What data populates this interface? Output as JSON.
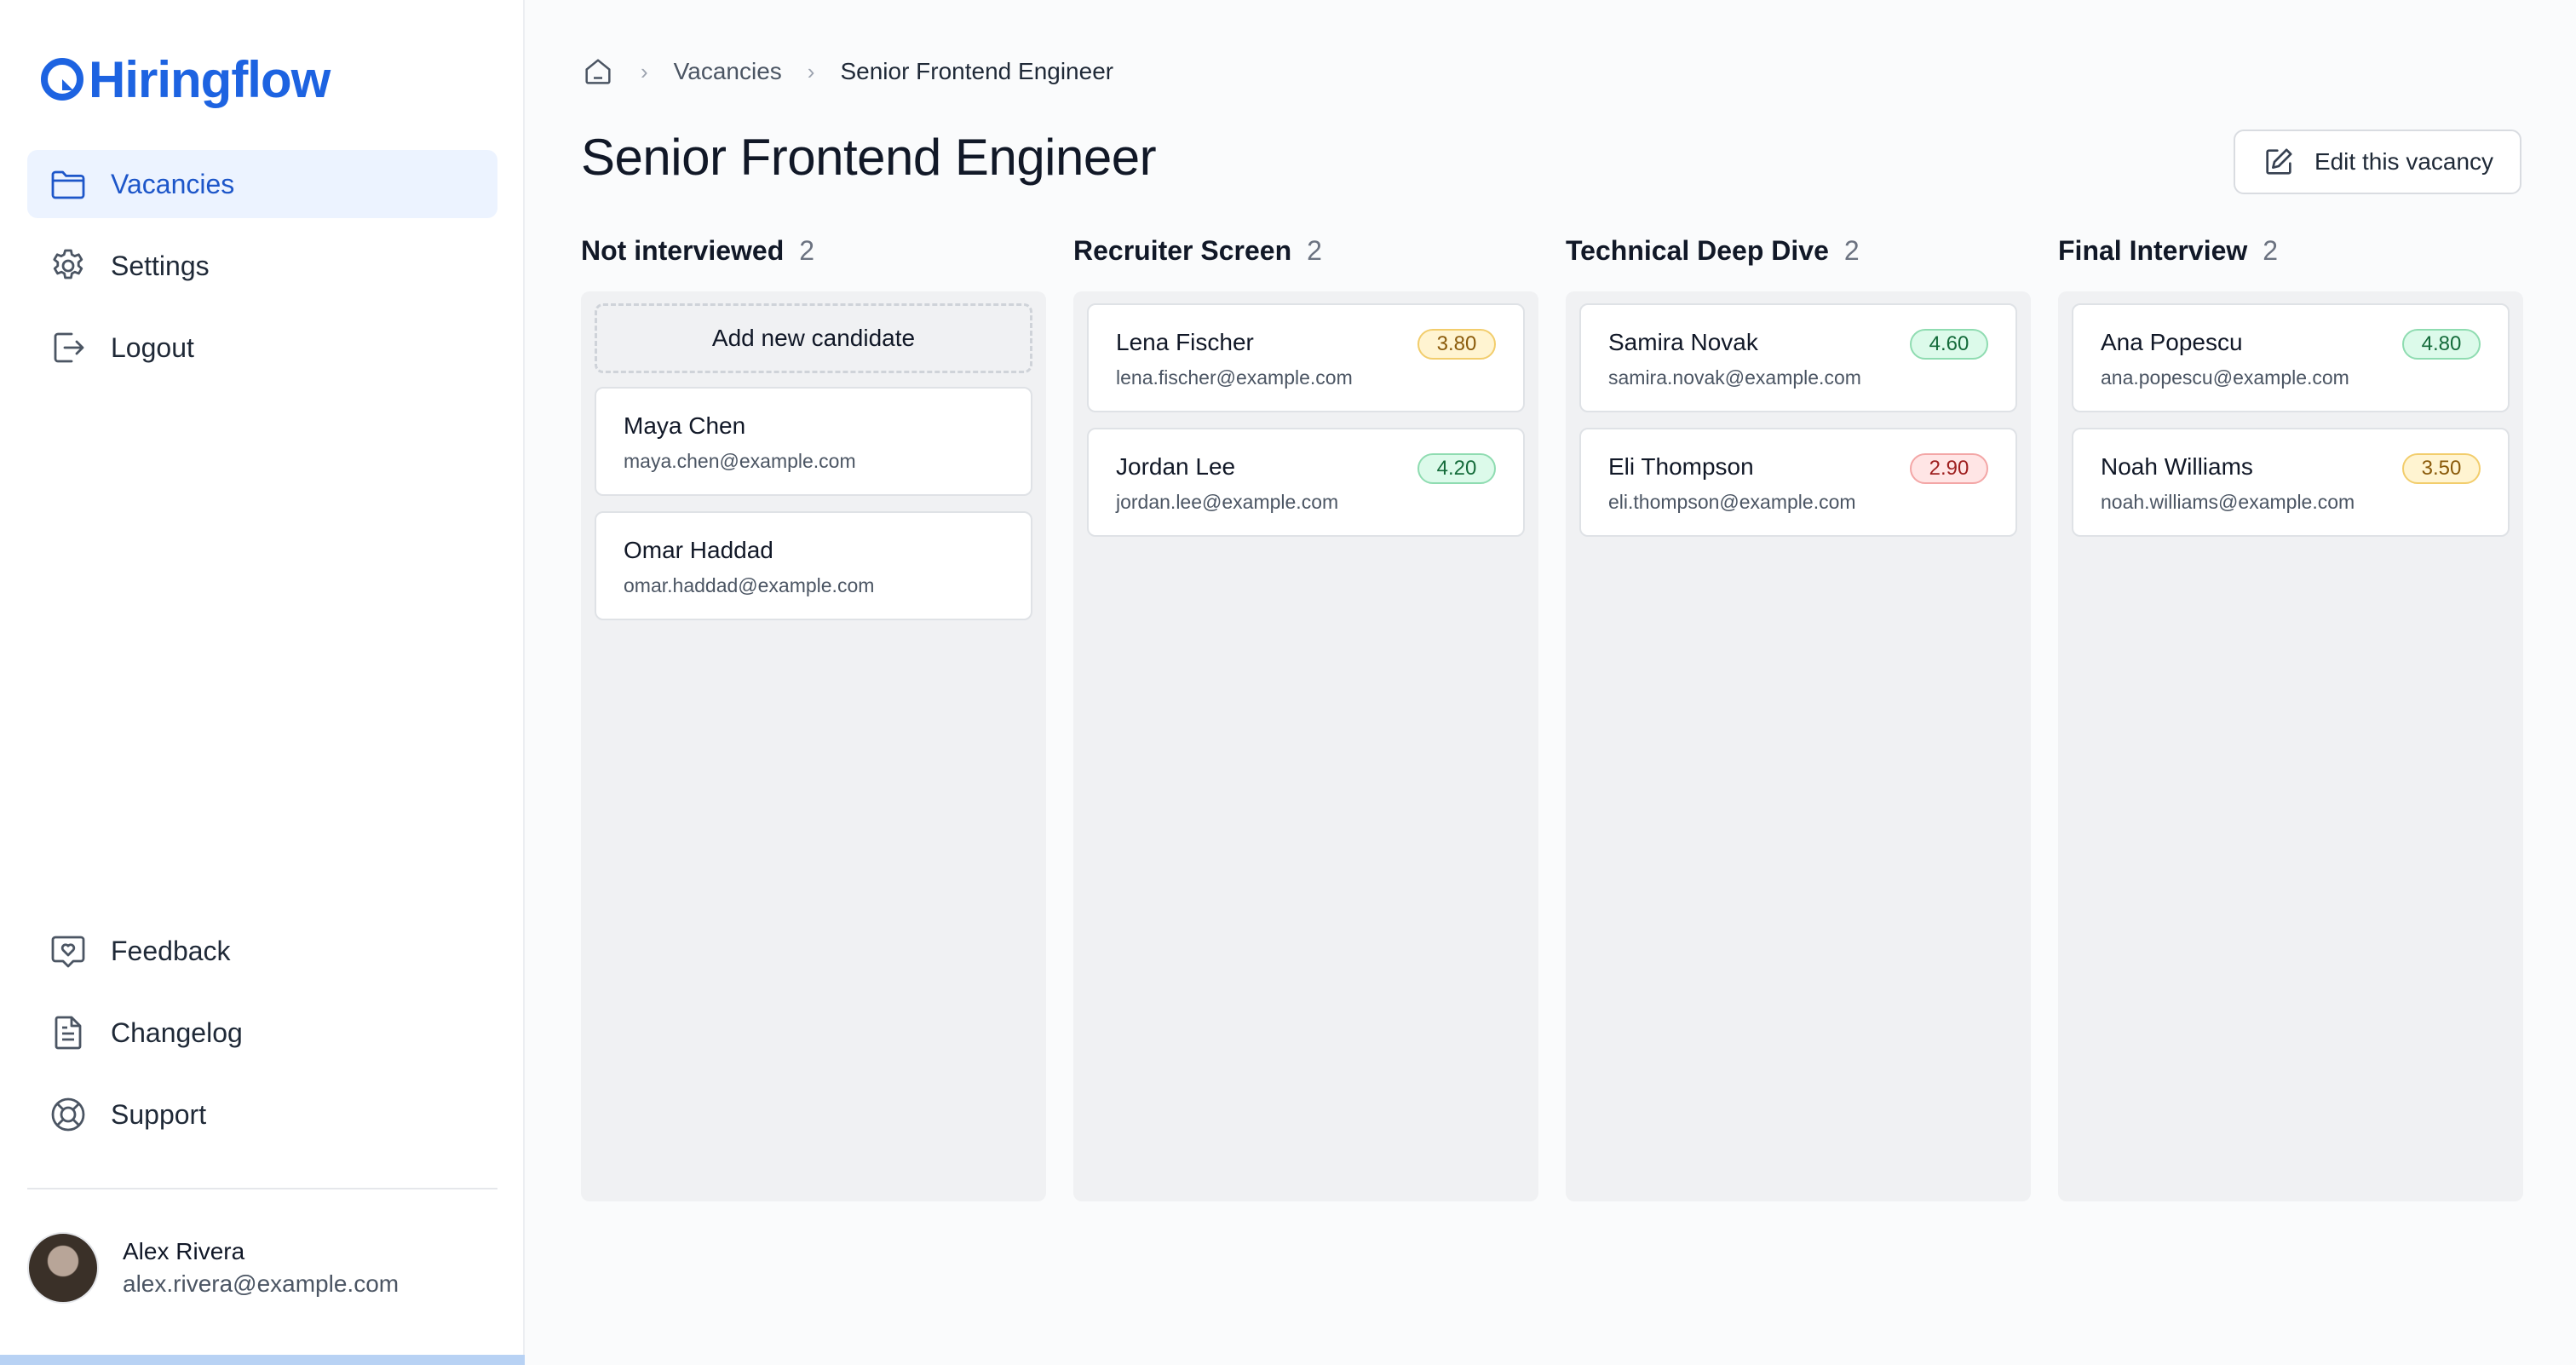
{
  "app": {
    "name": "Hiringflow",
    "brand_color": "#1d63e1"
  },
  "sidebar": {
    "top_items": [
      {
        "label": "Vacancies",
        "icon": "folder-icon",
        "active": true
      },
      {
        "label": "Settings",
        "icon": "gear-icon",
        "active": false
      },
      {
        "label": "Logout",
        "icon": "logout-icon",
        "active": false
      }
    ],
    "bottom_items": [
      {
        "label": "Feedback",
        "icon": "feedback-heart-icon"
      },
      {
        "label": "Changelog",
        "icon": "document-icon"
      },
      {
        "label": "Support",
        "icon": "lifebuoy-icon"
      }
    ],
    "user": {
      "name": "Alex Rivera",
      "email": "alex.rivera@example.com"
    },
    "progress_fraction": 1.0
  },
  "breadcrumb": {
    "home_icon": "home-icon",
    "items": [
      "Vacancies",
      "Senior Frontend Engineer"
    ]
  },
  "page": {
    "title": "Senior Frontend Engineer",
    "edit_label": "Edit this vacancy",
    "edit_icon": "edit-icon"
  },
  "add_candidate_label": "Add new candidate",
  "columns": [
    {
      "title": "Not interviewed",
      "count": "2",
      "candidates": [
        {
          "name": "Maya Chen",
          "email": "maya.chen@example.com"
        },
        {
          "name": "Omar Haddad",
          "email": "omar.haddad@example.com"
        }
      ]
    },
    {
      "title": "Recruiter Screen",
      "count": "2",
      "candidates": [
        {
          "name": "Lena Fischer",
          "email": "lena.fischer@example.com",
          "score": "3.80",
          "tone": "amber"
        },
        {
          "name": "Jordan Lee",
          "email": "jordan.lee@example.com",
          "score": "4.20",
          "tone": "green"
        }
      ]
    },
    {
      "title": "Technical Deep Dive",
      "count": "2",
      "candidates": [
        {
          "name": "Samira Novak",
          "email": "samira.novak@example.com",
          "score": "4.60",
          "tone": "green"
        },
        {
          "name": "Eli Thompson",
          "email": "eli.thompson@example.com",
          "score": "2.90",
          "tone": "red"
        }
      ]
    },
    {
      "title": "Final Interview",
      "count": "2",
      "candidates": [
        {
          "name": "Ana Popescu",
          "email": "ana.popescu@example.com",
          "score": "4.80",
          "tone": "green"
        },
        {
          "name": "Noah Williams",
          "email": "noah.williams@example.com",
          "score": "3.50",
          "tone": "amber"
        }
      ]
    }
  ]
}
